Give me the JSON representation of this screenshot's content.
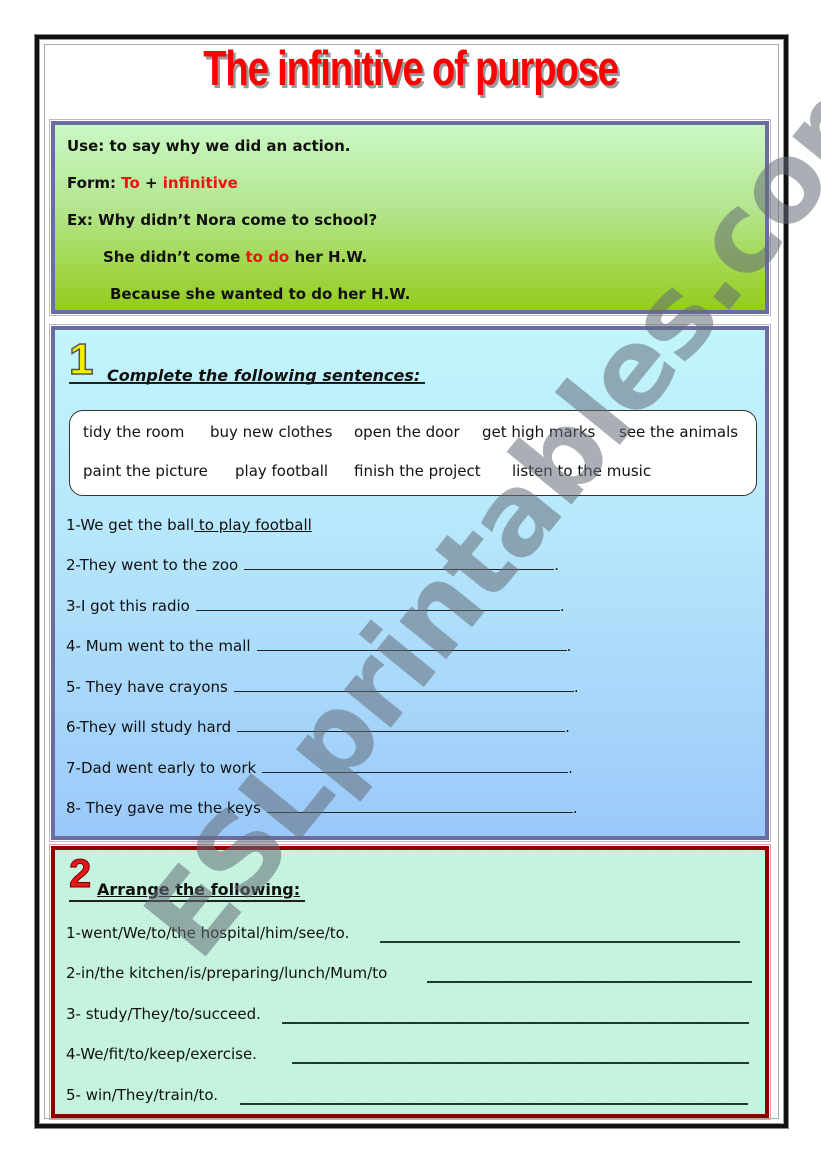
{
  "title": "The infinitive of purpose",
  "grammar_box": {
    "use_label": "Use:",
    "use_text": " to say why we did an action.",
    "form_label": "Form:",
    "form_to": "To",
    "form_plus": " + ",
    "form_infinitive": "infinitive",
    "example_label": "Ex:",
    "example_question": " Why didn’t Nora come to school?",
    "example_answer_start": "She didn’t come ",
    "example_answer_highlight": "to do",
    "example_answer_end": " her H.W.",
    "example_explanation": "Because she wanted to do her H.W."
  },
  "exercise1": {
    "number": "1",
    "heading": "Complete the following sentences:",
    "word_bank": [
      "tidy the room",
      "buy new clothes",
      "open the door",
      "get high marks",
      "see the animals",
      "paint the picture",
      "play football",
      "finish the project",
      "listen to the music"
    ],
    "example_sentence": "1-We get the ball",
    "example_answer": " to play football",
    "sentences": [
      "2-They went to the zoo",
      "3-I got this radio",
      "4- Mum went to the mall",
      "5- They have crayons",
      "6-They will study hard",
      "7-Dad went early to work",
      "8- They gave me the keys"
    ],
    "end_punctuation": "."
  },
  "exercise2": {
    "number": "2",
    "heading": "Arrange the following:",
    "items": [
      "1-went/We/to/the hospital/him/see/to.",
      "2-in/the kitchen/is/preparing/lunch/Mum/to",
      "3- study/They/to/succeed.",
      "4-We/fit/to/keep/exercise.",
      "5- win/They/train/to."
    ]
  },
  "watermark": "ESLprintables.com",
  "colors": {
    "title": "#ff0000",
    "highlight": "#ee1111",
    "box_border_blue": "#6c6ca0",
    "box_border_red": "#8b0000"
  }
}
